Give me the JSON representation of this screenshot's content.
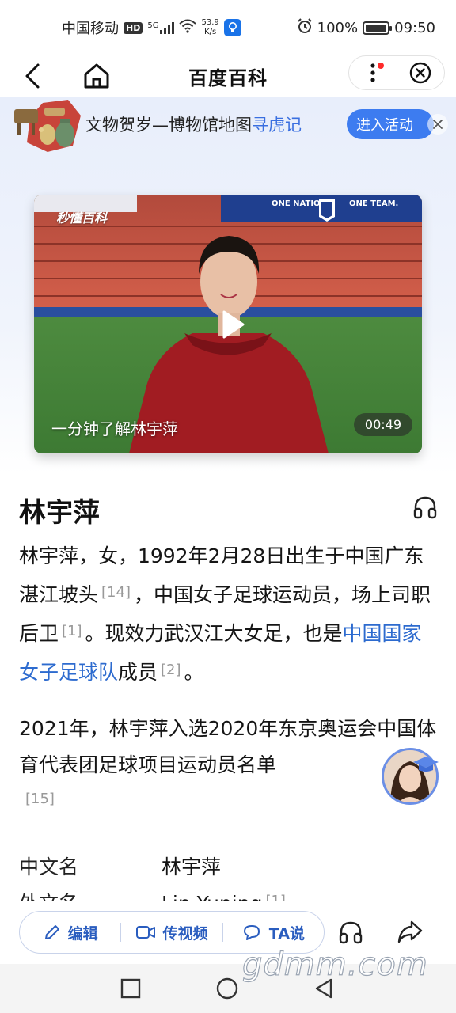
{
  "status_bar": {
    "carrier": "中国移动",
    "hd": "HD",
    "signal_type": "5G",
    "net_speed_value": "53.9",
    "net_speed_unit": "K/s",
    "battery": "100%",
    "time": "09:50"
  },
  "nav": {
    "title": "百度百科"
  },
  "banner": {
    "text_main": "文物贺岁—博物馆地图",
    "text_highlight": "寻虎记",
    "button": "进入活动"
  },
  "video": {
    "logo": "秒懂百科",
    "caption": "一分钟了解林宇萍",
    "duration": "00:49",
    "scene_text_left": "ONE NATION.",
    "scene_text_right": "ONE TEAM."
  },
  "article": {
    "title": "林宇萍",
    "p1_a": "林宇萍，女，1992年2月28日出生于中国广东湛江坡头",
    "p1_ref1": "[14]",
    "p1_b": "，中国女子足球运动员，场上司职后卫",
    "p1_ref2": "[1]",
    "p1_c": "。现效力武汉江大女足，也是",
    "p1_link": "中国国家女子足球队",
    "p1_d": "成员",
    "p1_ref3": "[2]",
    "p1_e": "。",
    "p2": "2021年，林宇萍入选2020年东京奥运会中国体育代表团足球项目运动员名单",
    "p2_ref": "[15]"
  },
  "infobox": {
    "rows": [
      {
        "key": "中文名",
        "value": "林宇萍",
        "ref": ""
      },
      {
        "key": "外文名",
        "value": "Lin Yuping",
        "ref": "[1]"
      }
    ]
  },
  "bottom_bar": {
    "edit": "编辑",
    "video": "传视频",
    "ta_say": "TA说"
  },
  "watermark": "gdmm.com",
  "colors": {
    "accent": "#3d7cf0",
    "link": "#2d6bcf",
    "pill_text": "#2a5dbf"
  }
}
